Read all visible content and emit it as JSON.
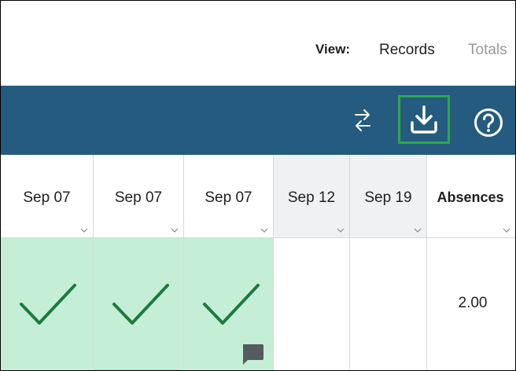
{
  "view": {
    "label": "View:",
    "options": [
      {
        "label": "Records",
        "selected": true
      },
      {
        "label": "Totals",
        "selected": false
      }
    ]
  },
  "toolbar": {
    "color": "#245b7f",
    "buttons": [
      {
        "icon": "swap-arrows-icon"
      },
      {
        "icon": "download-icon",
        "highlighted": true,
        "highlight_color": "#2ea84a"
      },
      {
        "icon": "help-circle-icon"
      }
    ]
  },
  "columns": [
    {
      "label": "Sep 07",
      "shaded": false
    },
    {
      "label": "Sep 07",
      "shaded": false
    },
    {
      "label": "Sep 07",
      "shaded": false
    },
    {
      "label": "Sep 12",
      "shaded": true
    },
    {
      "label": "Sep 19",
      "shaded": true
    },
    {
      "label": "Absences",
      "shaded": false
    }
  ],
  "row": {
    "cells": [
      {
        "status": "present",
        "icon": "checkmark-icon"
      },
      {
        "status": "present",
        "icon": "checkmark-icon"
      },
      {
        "status": "present",
        "icon": "checkmark-icon",
        "has_comment": true
      },
      {
        "status": "empty"
      },
      {
        "status": "empty"
      },
      {
        "value": "2.00"
      }
    ]
  },
  "colors": {
    "present_bg": "#c5eed6",
    "check": "#1d7a3d"
  }
}
